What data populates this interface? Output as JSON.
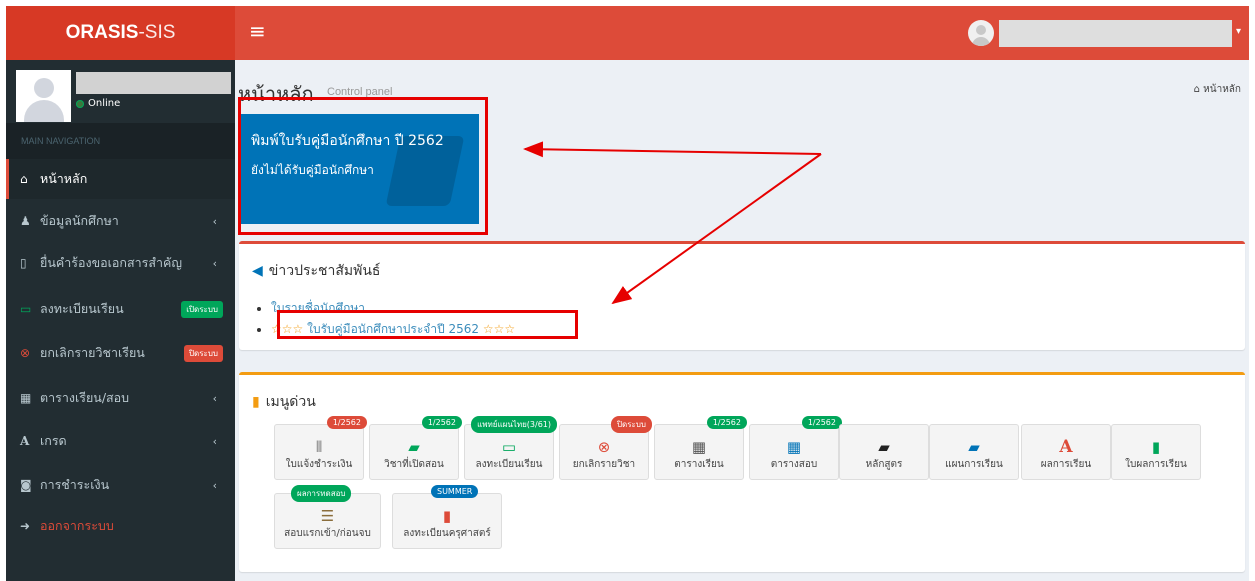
{
  "logo": {
    "bold": "ORASIS",
    "rest": "-SIS"
  },
  "topbar": {
    "menu_icon": "hamburger-icon",
    "caret": "▾"
  },
  "sidebar": {
    "status": "Online",
    "nav_header": "MAIN NAVIGATION",
    "items": [
      {
        "label": "หน้าหลัก",
        "icon": "home-icon"
      },
      {
        "label": "ข้อมูลนักศึกษา",
        "icon": "user-icon"
      },
      {
        "label": "ยื่นคำร้องขอเอกสารสำคัญ",
        "icon": "file-icon"
      },
      {
        "label": "ลงทะเบียนเรียน",
        "icon": "monitor-icon",
        "badge": "เปิดระบบ"
      },
      {
        "label": "ยกเลิกรายวิชาเรียน",
        "icon": "cancel-icon",
        "badge": "ปิดระบบ"
      },
      {
        "label": "ตารางเรียน/สอบ",
        "icon": "calendar-icon"
      },
      {
        "label": "เกรด",
        "icon": "font-icon"
      },
      {
        "label": "การชำระเงิน",
        "icon": "money-icon"
      },
      {
        "label": "ออกจากระบบ",
        "icon": "sign-out-icon"
      }
    ]
  },
  "page": {
    "title": "หน้าหลัก",
    "subtitle": "Control panel",
    "breadcrumb": "หน้าหลัก"
  },
  "infobox": {
    "title": "พิมพ์ใบรับคู่มือนักศึกษา ปี 2562",
    "status": "ยังไม่ได้รับคู่มือนักศึกษา"
  },
  "news": {
    "title": "ข่าวประชาสัมพันธ์",
    "items": [
      {
        "text": "ใบรายชื่อนักศึกษา"
      },
      {
        "stars": "☆☆☆",
        "text": "ใบรับคู่มือนักศึกษาประจำปี 2562"
      }
    ]
  },
  "quick_menu": {
    "title": "เมนูด่วน",
    "tiles": [
      {
        "label": "ใบแจ้งชำระเงิน",
        "icon": "barcode-icon",
        "badge": "1/2562",
        "badge_color": "red"
      },
      {
        "label": "วิชาที่เปิดสอน",
        "icon": "book-icon",
        "badge": "1/2562",
        "badge_color": "green"
      },
      {
        "label": "ลงทะเบียนเรียน",
        "icon": "monitor-icon",
        "badge": "แพทย์แผนไทย(3/61)",
        "badge_color": "green"
      },
      {
        "label": "ยกเลิกรายวิชา",
        "icon": "cancel-icon",
        "badge": "ปิดระบบ",
        "badge_color": "red"
      },
      {
        "label": "ตารางเรียน",
        "icon": "calendar-icon",
        "badge": "1/2562",
        "badge_color": "green"
      },
      {
        "label": "ตารางสอบ",
        "icon": "calendar-icon",
        "badge": "1/2562",
        "badge_color": "green"
      },
      {
        "label": "หลักสูตร",
        "icon": "book-icon"
      },
      {
        "label": "แผนการเรียน",
        "icon": "book-icon"
      },
      {
        "label": "ผลการเรียน",
        "icon": "font-icon"
      },
      {
        "label": "ใบผลการเรียน",
        "icon": "file-icon"
      },
      {
        "label": "สอบแรกเข้า/ก่อนจบ",
        "icon": "stack-icon",
        "badge": "ผลการทดสอบ",
        "badge_color": "green"
      },
      {
        "label": "ลงทะเบียนครุศาสตร์",
        "icon": "file-icon",
        "badge": "SUMMER",
        "badge_color": "blue"
      }
    ]
  }
}
